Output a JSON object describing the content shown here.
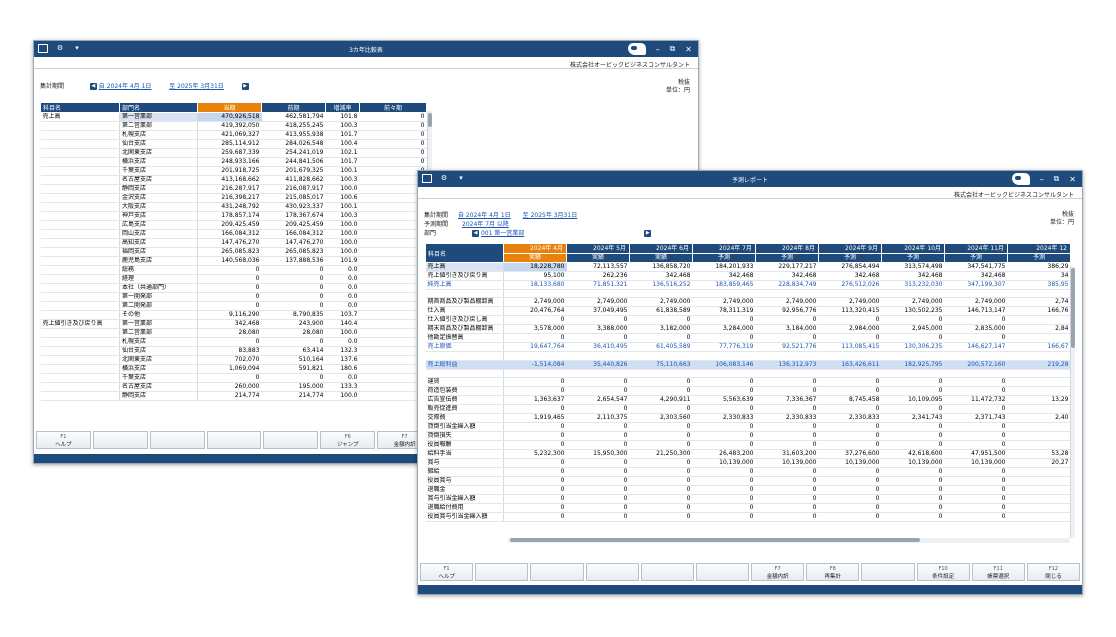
{
  "window1": {
    "title": "3カ年比較表",
    "company": "株式会社オービックビジネスコンサルタント",
    "period_label": "集計期間",
    "period_from": "自 2024年 4月 1日",
    "period_to": "至 2025年 3月31日",
    "tax": "税抜",
    "unit": "単位：円",
    "headers": [
      "科目名",
      "部門名",
      "当期",
      "前期",
      "増減率",
      "前々期"
    ],
    "rows": [
      [
        "売上高",
        "第一営業部",
        "470,926,518",
        "462,581,794",
        "101.8",
        "0"
      ],
      [
        "",
        "第二営業部",
        "419,392,050",
        "418,255,245",
        "100.3",
        "0"
      ],
      [
        "",
        "札幌支店",
        "421,069,327",
        "413,955,938",
        "101.7",
        "0"
      ],
      [
        "",
        "仙台支店",
        "285,114,912",
        "284,026,548",
        "100.4",
        "0"
      ],
      [
        "",
        "北関東支店",
        "259,687,339",
        "254,241,019",
        "102.1",
        "0"
      ],
      [
        "",
        "横浜支店",
        "248,933,166",
        "244,841,506",
        "101.7",
        "0"
      ],
      [
        "",
        "千葉支店",
        "201,918,725",
        "201,679,325",
        "100.1",
        "0"
      ],
      [
        "",
        "名古屋支店",
        "413,168,662",
        "411,828,662",
        "100.3",
        "0"
      ],
      [
        "",
        "静岡支店",
        "216,287,917",
        "216,087,917",
        "100.0",
        "0"
      ],
      [
        "",
        "金沢支店",
        "216,398,217",
        "215,085,017",
        "100.6",
        "0"
      ],
      [
        "",
        "大阪支店",
        "431,248,792",
        "430,923,337",
        "100.1",
        "0"
      ],
      [
        "",
        "神戸支店",
        "178,857,174",
        "178,367,674",
        "100.3",
        "0"
      ],
      [
        "",
        "広島支店",
        "209,425,459",
        "209,425,459",
        "100.0",
        "0"
      ],
      [
        "",
        "岡山支店",
        "166,084,312",
        "166,084,312",
        "100.0",
        "0"
      ],
      [
        "",
        "高知支店",
        "147,476,270",
        "147,476,270",
        "100.0",
        "0"
      ],
      [
        "",
        "福岡支店",
        "265,085,823",
        "265,085,823",
        "100.0",
        "0"
      ],
      [
        "",
        "鹿児島支店",
        "140,568,036",
        "137,888,536",
        "101.9",
        "0"
      ],
      [
        "",
        "総務",
        "0",
        "0",
        "0.0",
        "0"
      ],
      [
        "",
        "経理",
        "0",
        "0",
        "0.0",
        "0"
      ],
      [
        "",
        "本社（共通部門）",
        "0",
        "0",
        "0.0",
        "0"
      ],
      [
        "",
        "第一開発部",
        "0",
        "0",
        "0.0",
        "0"
      ],
      [
        "",
        "第二開発部",
        "0",
        "0",
        "0.0",
        "0"
      ],
      [
        "",
        "その他",
        "9,116,290",
        "8,790,835",
        "103.7",
        "0"
      ],
      [
        "売上値引き及び戻り高",
        "第一営業部",
        "342,468",
        "243,900",
        "140.4",
        "0"
      ],
      [
        "",
        "第二営業部",
        "28,080",
        "28,080",
        "100.0",
        "0"
      ],
      [
        "",
        "札幌支店",
        "0",
        "0",
        "0.0",
        "0"
      ],
      [
        "",
        "仙台支店",
        "83,883",
        "63,414",
        "132.3",
        "0"
      ],
      [
        "",
        "北関東支店",
        "702,070",
        "510,164",
        "137.6",
        "0"
      ],
      [
        "",
        "横浜支店",
        "1,069,094",
        "591,821",
        "180.6",
        "0"
      ],
      [
        "",
        "千葉支店",
        "0",
        "0",
        "0.0",
        "0"
      ],
      [
        "",
        "名古屋支店",
        "260,000",
        "195,000",
        "133.3",
        "0"
      ],
      [
        "",
        "静岡支店",
        "214,774",
        "214,774",
        "100.0",
        "0"
      ]
    ],
    "fkeys": [
      {
        "key": "F1",
        "label": "ヘルプ"
      },
      {
        "key": "",
        "label": ""
      },
      {
        "key": "",
        "label": ""
      },
      {
        "key": "",
        "label": ""
      },
      {
        "key": "",
        "label": ""
      },
      {
        "key": "F6",
        "label": "ジャンプ"
      },
      {
        "key": "F7",
        "label": "金額内訳"
      }
    ]
  },
  "window2": {
    "title": "予測レポート",
    "company": "株式会社オービックビジネスコンサルタント",
    "period_label": "集計期間",
    "period_from": "自 2024年 4月 1日",
    "period_to": "至 2025年 3月31日",
    "forecast_label": "予測期間",
    "forecast_value": "2024年 7月 以降",
    "dept_label": "部門",
    "dept_value": "001 第一営業部",
    "tax": "税抜",
    "unit": "単位：円",
    "account_header": "科目名",
    "months": [
      "2024年 4月",
      "2024年 5月",
      "2024年 6月",
      "2024年 7月",
      "2024年 8月",
      "2024年 9月",
      "2024年 10月",
      "2024年 11月",
      "2024年 12"
    ],
    "kinds": [
      "実績",
      "実績",
      "実績",
      "予測",
      "予測",
      "予測",
      "予測",
      "予測",
      "予測"
    ],
    "rows": [
      {
        "name": "売上高",
        "vals": [
          "18,228,780",
          "72,113,557",
          "136,858,720",
          "184,201,933",
          "229,177,217",
          "276,854,494",
          "313,574,498",
          "347,541,775",
          "386,29"
        ]
      },
      {
        "name": "売上値引き及び戻り高",
        "vals": [
          "95,100",
          "262,236",
          "342,468",
          "342,468",
          "342,468",
          "342,468",
          "342,468",
          "342,468",
          "34"
        ]
      },
      {
        "name": "純売上高",
        "vals": [
          "18,133,680",
          "71,851,321",
          "136,516,252",
          "183,859,465",
          "228,834,749",
          "276,512,026",
          "313,232,030",
          "347,199,307",
          "385,95"
        ],
        "blue": true
      },
      {
        "name": "",
        "vals": [
          "",
          "",
          "",
          "",
          "",
          "",
          "",
          "",
          ""
        ]
      },
      {
        "name": "期首商品及び製品棚卸高",
        "vals": [
          "2,749,000",
          "2,749,000",
          "2,749,000",
          "2,749,000",
          "2,749,000",
          "2,749,000",
          "2,749,000",
          "2,749,000",
          "2,74"
        ]
      },
      {
        "name": "仕入高",
        "vals": [
          "20,476,764",
          "37,049,495",
          "61,838,589",
          "78,311,319",
          "92,956,776",
          "113,320,415",
          "130,502,235",
          "146,713,147",
          "166,76"
        ]
      },
      {
        "name": "仕入値引き及び戻し高",
        "vals": [
          "0",
          "0",
          "0",
          "0",
          "0",
          "0",
          "0",
          "0",
          ""
        ]
      },
      {
        "name": "期末商品及び製品棚卸高",
        "vals": [
          "3,578,000",
          "3,388,000",
          "3,182,000",
          "3,284,000",
          "3,184,000",
          "2,984,000",
          "2,945,000",
          "2,835,000",
          "2,84"
        ]
      },
      {
        "name": "他勘定振替高",
        "vals": [
          "0",
          "0",
          "0",
          "0",
          "0",
          "0",
          "0",
          "0",
          ""
        ]
      },
      {
        "name": "売上原価",
        "vals": [
          "19,647,764",
          "36,410,495",
          "61,405,589",
          "77,776,319",
          "92,521,776",
          "113,085,415",
          "130,306,235",
          "146,627,147",
          "166,67"
        ],
        "blue": true
      },
      {
        "name": "",
        "vals": [
          "",
          "",
          "",
          "",
          "",
          "",
          "",
          "",
          ""
        ]
      },
      {
        "name": "売上総利益",
        "vals": [
          "-1,514,084",
          "35,440,826",
          "75,110,663",
          "106,083,146",
          "136,312,973",
          "163,426,611",
          "182,925,795",
          "200,572,160",
          "219,28"
        ],
        "blue": true,
        "hl": true
      },
      {
        "name": "",
        "vals": [
          "",
          "",
          "",
          "",
          "",
          "",
          "",
          "",
          ""
        ]
      },
      {
        "name": "運賃",
        "vals": [
          "0",
          "0",
          "0",
          "0",
          "0",
          "0",
          "0",
          "0",
          ""
        ]
      },
      {
        "name": "荷造包装費",
        "vals": [
          "0",
          "0",
          "0",
          "0",
          "0",
          "0",
          "0",
          "0",
          ""
        ]
      },
      {
        "name": "広告宣伝費",
        "vals": [
          "1,363,637",
          "2,654,547",
          "4,290,911",
          "5,563,639",
          "7,336,367",
          "8,745,458",
          "10,109,095",
          "11,472,732",
          "13,29"
        ]
      },
      {
        "name": "販売促進費",
        "vals": [
          "0",
          "0",
          "0",
          "0",
          "0",
          "0",
          "0",
          "0",
          ""
        ]
      },
      {
        "name": "交際費",
        "vals": [
          "1,919,465",
          "2,110,375",
          "2,303,560",
          "2,330,833",
          "2,330,833",
          "2,330,833",
          "2,341,743",
          "2,371,743",
          "2,40"
        ]
      },
      {
        "name": "貸倒引当金繰入額",
        "vals": [
          "0",
          "0",
          "0",
          "0",
          "0",
          "0",
          "0",
          "0",
          ""
        ]
      },
      {
        "name": "貸倒損失",
        "vals": [
          "0",
          "0",
          "0",
          "0",
          "0",
          "0",
          "0",
          "0",
          ""
        ]
      },
      {
        "name": "役員報酬",
        "vals": [
          "0",
          "0",
          "0",
          "0",
          "0",
          "0",
          "0",
          "0",
          ""
        ]
      },
      {
        "name": "給料手当",
        "vals": [
          "5,232,300",
          "15,950,300",
          "21,250,300",
          "26,483,200",
          "31,603,200",
          "37,276,600",
          "42,618,600",
          "47,951,500",
          "53,28"
        ]
      },
      {
        "name": "賞与",
        "vals": [
          "0",
          "0",
          "0",
          "10,139,000",
          "10,139,000",
          "10,139,000",
          "10,139,000",
          "10,139,000",
          "20,27"
        ]
      },
      {
        "name": "雑給",
        "vals": [
          "0",
          "0",
          "0",
          "0",
          "0",
          "0",
          "0",
          "0",
          ""
        ]
      },
      {
        "name": "役員賞与",
        "vals": [
          "0",
          "0",
          "0",
          "0",
          "0",
          "0",
          "0",
          "0",
          ""
        ]
      },
      {
        "name": "退職金",
        "vals": [
          "0",
          "0",
          "0",
          "0",
          "0",
          "0",
          "0",
          "0",
          ""
        ]
      },
      {
        "name": "賞与引当金繰入額",
        "vals": [
          "0",
          "0",
          "0",
          "0",
          "0",
          "0",
          "0",
          "0",
          ""
        ]
      },
      {
        "name": "退職給付費用",
        "vals": [
          "0",
          "0",
          "0",
          "0",
          "0",
          "0",
          "0",
          "0",
          ""
        ]
      },
      {
        "name": "役員賞与引当金繰入額",
        "vals": [
          "0",
          "0",
          "0",
          "0",
          "0",
          "0",
          "0",
          "0",
          ""
        ]
      }
    ],
    "fkeys": [
      {
        "key": "F1",
        "label": "ヘルプ"
      },
      {
        "key": "",
        "label": ""
      },
      {
        "key": "",
        "label": ""
      },
      {
        "key": "",
        "label": ""
      },
      {
        "key": "",
        "label": ""
      },
      {
        "key": "",
        "label": ""
      },
      {
        "key": "F7",
        "label": "金額内訳"
      },
      {
        "key": "F8",
        "label": "再集計"
      },
      {
        "key": "",
        "label": ""
      },
      {
        "key": "F10",
        "label": "条件設定"
      },
      {
        "key": "F11",
        "label": "帳票選択"
      },
      {
        "key": "F12",
        "label": "閉じる"
      }
    ]
  }
}
